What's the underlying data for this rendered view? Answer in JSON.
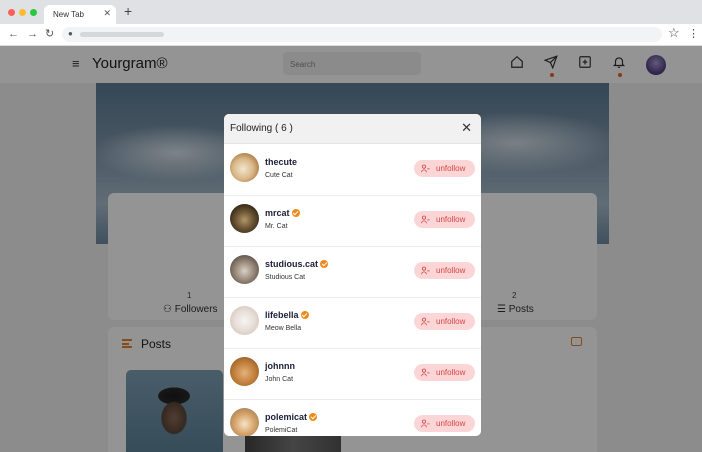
{
  "browser": {
    "tab_title": "New Tab",
    "tab_close": "✕",
    "new_tab": "+",
    "back": "←",
    "forward": "→",
    "reload": "↻",
    "lock": "🔒",
    "star": "☆",
    "menu": "⋮"
  },
  "header": {
    "menu_glyph": "≡",
    "brand": "Yourgram®",
    "search_placeholder": "Search",
    "icons": [
      "home-icon",
      "send-icon",
      "add-post-icon",
      "bell-icon"
    ]
  },
  "profile": {
    "followers_count": "1",
    "followers_label": "Followers",
    "posts_count": "2",
    "posts_label": "Posts",
    "posts_section_title": "Posts"
  },
  "modal": {
    "title": "Following ( 6 )",
    "close": "✕",
    "unfollow_label": "unfollow",
    "accent": "#d24545",
    "verified_color": "#f08a1c",
    "users": [
      {
        "username": "thecute",
        "display_name": "Cute Cat",
        "verified": false
      },
      {
        "username": "mrcat",
        "display_name": "Mr. Cat",
        "verified": true
      },
      {
        "username": "studious.cat",
        "display_name": "Studious Cat",
        "verified": true
      },
      {
        "username": "lifebella",
        "display_name": "Meow Bella",
        "verified": true
      },
      {
        "username": "johnnn",
        "display_name": "John Cat",
        "verified": false
      },
      {
        "username": "polemicat",
        "display_name": "PolemiCat",
        "verified": true
      }
    ]
  }
}
